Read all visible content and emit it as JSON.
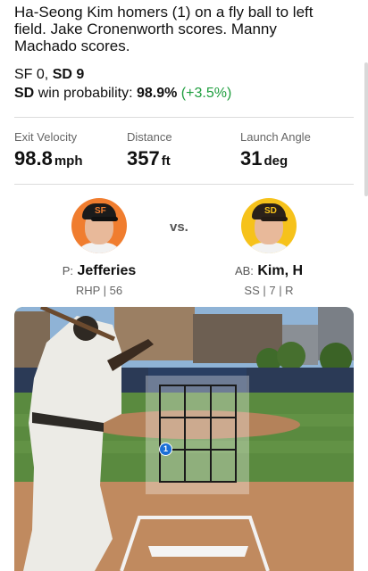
{
  "play": {
    "description": "Ha-Seong Kim homers (1) on a fly ball to left field. Jake Cronenworth scores. Manny Machado scores."
  },
  "score": {
    "away_team": "SF",
    "away_runs": "0,",
    "home_team": "SD",
    "home_runs": "9"
  },
  "win_probability": {
    "team": "SD",
    "label": "win probability:",
    "value": "98.9%",
    "delta": "(+3.5%)"
  },
  "statcast": [
    {
      "label": "Exit Velocity",
      "value": "98.8",
      "unit": "mph"
    },
    {
      "label": "Distance",
      "value": "357",
      "unit": "ft"
    },
    {
      "label": "Launch Angle",
      "value": "31",
      "unit": "deg"
    }
  ],
  "matchup": {
    "vs_label": "vs.",
    "pitcher": {
      "role": "P:",
      "name": "Jefferies",
      "details": "RHP | 56",
      "cap_logo": "SF"
    },
    "batter": {
      "role": "AB:",
      "name": "Kim, H",
      "details": "SS | 7 | R",
      "cap_logo": "SD"
    }
  },
  "pitch_location": {
    "pitch_number": "1"
  },
  "colors": {
    "pitcher_bg": "#f07d2f",
    "batter_bg": "#f6c21b",
    "positive_delta": "#1e9e3e",
    "pitch_marker": "#1b6fd6"
  }
}
